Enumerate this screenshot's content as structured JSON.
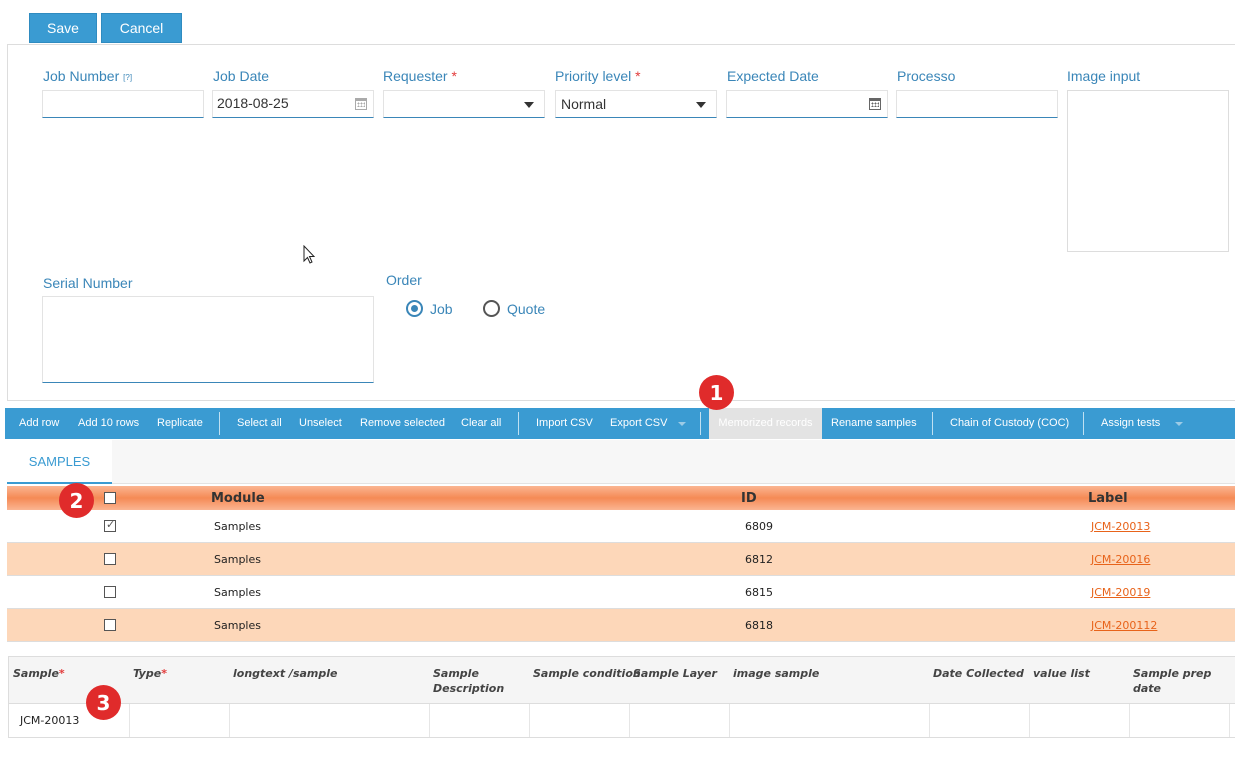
{
  "top_buttons": {
    "save": "Save",
    "cancel": "Cancel"
  },
  "form": {
    "job_number": {
      "label": "Job Number",
      "help": "[?]",
      "value": ""
    },
    "job_date": {
      "label": "Job Date",
      "value": "2018-08-25"
    },
    "requester": {
      "label": "Requester",
      "required": "*",
      "value": ""
    },
    "priority_level": {
      "label": "Priority level",
      "required": "*",
      "value": "Normal"
    },
    "expected_date": {
      "label": "Expected Date",
      "value": ""
    },
    "processo": {
      "label": "Processo",
      "value": ""
    },
    "image_input": {
      "label": "Image input"
    },
    "serial_number": {
      "label": "Serial Number"
    },
    "order": {
      "label": "Order",
      "options": [
        "Job",
        "Quote"
      ],
      "selected": "Job"
    }
  },
  "toolbar": {
    "add_row": "Add row",
    "add_10_rows": "Add 10 rows",
    "replicate": "Replicate",
    "select_all": "Select all",
    "unselect": "Unselect",
    "remove_selected": "Remove selected",
    "clear_all": "Clear all",
    "import_csv": "Import CSV",
    "export_csv": "Export CSV",
    "memorized_records": "Memorized records",
    "rename_samples": "Rename samples",
    "chain_of_custody": "Chain of Custody (COC)",
    "assign_tests": "Assign tests"
  },
  "tabs": {
    "samples": "SAMPLES"
  },
  "grid": {
    "columns": {
      "module": "Module",
      "id": "ID",
      "label": "Label"
    },
    "rows": [
      {
        "checked": true,
        "module": "Samples",
        "id": "6809",
        "label": "JCM-20013"
      },
      {
        "checked": false,
        "module": "Samples",
        "id": "6812",
        "label": "JCM-20016"
      },
      {
        "checked": false,
        "module": "Samples",
        "id": "6815",
        "label": "JCM-20019"
      },
      {
        "checked": false,
        "module": "Samples",
        "id": "6818",
        "label": "JCM-200112"
      }
    ]
  },
  "sample_table": {
    "columns": {
      "sample": "Sample",
      "sample_req": "*",
      "type": "Type",
      "type_req": "*",
      "longtext": "longtext /sample",
      "sample_description": "Sample Description",
      "sample_condition": "Sample condition",
      "sample_layer": "Sample Layer",
      "image_sample": "image sample",
      "date_collected": "Date Collected",
      "value_list": "value list",
      "sample_prep_date": "Sample prep date"
    },
    "rows": [
      {
        "sample": "JCM-20013"
      }
    ]
  },
  "annotations": {
    "one": "1",
    "two": "2",
    "three": "3"
  },
  "colors": {
    "accent": "#3a9bd2",
    "header_orange": "#f58a55",
    "row_alt": "#fdd7b9",
    "link": "#e8631a",
    "badge": "#e02b2b"
  }
}
